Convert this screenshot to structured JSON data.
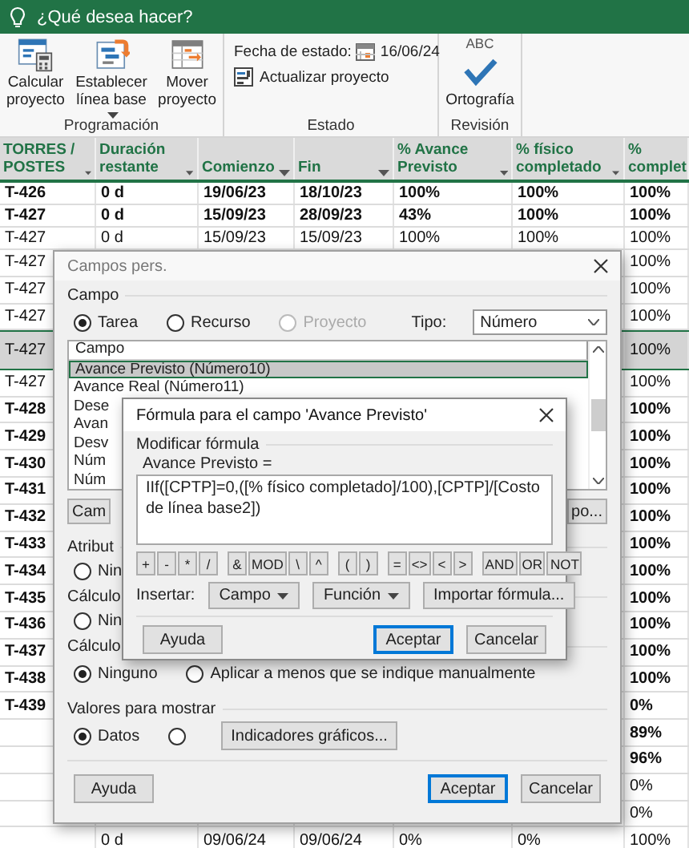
{
  "tell_me": {
    "label": "¿Qué desea hacer?"
  },
  "ribbon": {
    "groups": [
      {
        "label": "Programación",
        "kind": "large",
        "buttons": [
          {
            "label": "Calcular proyecto",
            "kind": "calculate",
            "dropdown": false
          },
          {
            "label": "Establecer línea base",
            "kind": "baseline",
            "dropdown": true
          },
          {
            "label": "Mover proyecto",
            "kind": "move",
            "dropdown": false
          }
        ]
      },
      {
        "label": "Estado",
        "kind": "status",
        "date_label": "Fecha de estado:",
        "date": "16/06/24",
        "update": "Actualizar proyecto"
      },
      {
        "label": "Revisión",
        "kind": "large",
        "buttons": [
          {
            "label": "Ortografía",
            "kind": "spelling",
            "icon_text": "ABC",
            "dropdown": false
          }
        ]
      }
    ]
  },
  "table": {
    "columns": [
      {
        "label": "TORRES / POSTES",
        "filter": true
      },
      {
        "label": "Duración restante",
        "filter": true
      },
      {
        "label": "Comienzo",
        "filter": true
      },
      {
        "label": "Fin",
        "filter": true
      },
      {
        "label": "% Avance Previsto",
        "filter": true
      },
      {
        "label": "% físico completado",
        "filter": true
      },
      {
        "label": "% complet"
      }
    ],
    "rows": [
      {
        "torres": "T-426",
        "duracion": "0 d",
        "comienzo": "19/06/23",
        "fin": "18/10/23",
        "avance_previsto": "100%",
        "fisico_completado": "100%",
        "completado": "100%",
        "bold": true,
        "selected": false
      },
      {
        "torres": "T-427",
        "duracion": "0 d",
        "comienzo": "15/09/23",
        "fin": "28/09/23",
        "avance_previsto": "43%",
        "fisico_completado": "100%",
        "completado": "100%",
        "bold": true,
        "selected": false
      },
      {
        "torres": "T-427",
        "duracion": "0 d",
        "comienzo": "15/09/23",
        "fin": "15/09/23",
        "avance_previsto": "100%",
        "fisico_completado": "100%",
        "completado": "100%",
        "bold": false,
        "selected": false
      },
      {
        "torres": "T-427",
        "completado": "100%",
        "bold": false,
        "selected": false
      },
      {
        "torres": "T-427",
        "completado": "100%",
        "bold": false,
        "selected": false
      },
      {
        "torres": "T-427",
        "completado": "100%",
        "bold": false,
        "selected": false
      },
      {
        "torres": "T-427",
        "completado": "100%",
        "bold": false,
        "selected": true
      },
      {
        "torres": "T-427",
        "completado": "100%",
        "bold": false,
        "selected": false
      },
      {
        "torres": "T-428",
        "completado": "100%",
        "bold": true,
        "selected": false
      },
      {
        "torres": "T-429",
        "completado": "100%",
        "bold": true,
        "selected": false
      },
      {
        "torres": "T-430",
        "completado": "100%",
        "bold": true,
        "selected": false
      },
      {
        "torres": "T-431",
        "completado": "100%",
        "bold": true,
        "selected": false
      },
      {
        "torres": "T-432",
        "completado": "100%",
        "bold": true,
        "selected": false
      },
      {
        "torres": "T-433",
        "completado": "100%",
        "bold": true,
        "selected": false
      },
      {
        "torres": "T-434",
        "completado": "100%",
        "bold": true,
        "selected": false
      },
      {
        "torres": "T-435",
        "completado": "100%",
        "bold": true,
        "selected": false
      },
      {
        "torres": "T-436",
        "completado": "100%",
        "bold": true,
        "selected": false
      },
      {
        "torres": "T-437",
        "completado": "100%",
        "bold": true,
        "selected": false
      },
      {
        "torres": "T-438",
        "completado": "100%",
        "bold": true,
        "selected": false
      },
      {
        "torres": "T-439",
        "completado": "0%",
        "bold": true,
        "selected": false
      },
      {
        "completado": "89%",
        "bold": true,
        "selected": false
      },
      {
        "completado": "96%",
        "bold": true,
        "selected": false
      },
      {
        "completado": "0%",
        "bold": false,
        "selected": false
      },
      {
        "completado": "0%",
        "bold": false,
        "selected": false
      },
      {
        "duracion": "0 d",
        "comienzo": "09/06/24",
        "fin": "09/06/24",
        "avance_previsto": "0%",
        "fisico_completado": "0%",
        "completado": "100%",
        "bold": false,
        "selected": false
      }
    ]
  },
  "custom_fields_dialog": {
    "title": "Campos pers.",
    "field_section": "Campo",
    "field_types": [
      {
        "label": "Tarea",
        "selected": true,
        "disabled": false
      },
      {
        "label": "Recurso",
        "selected": false,
        "disabled": false
      },
      {
        "label": "Proyecto",
        "selected": false,
        "disabled": true
      }
    ],
    "type_label": "Tipo:",
    "type": {
      "value": "Número"
    },
    "field_list": {
      "header": "Campo",
      "items": [
        {
          "label": "Avance Previsto (Número10)",
          "selected": true
        },
        {
          "label": "Avance Real (Número11)",
          "selected": false
        },
        {
          "label": "Dese",
          "selected": false
        },
        {
          "label": "Avan",
          "selected": false
        },
        {
          "label": "Desv",
          "selected": false
        },
        {
          "label": "Núm",
          "selected": false
        },
        {
          "label": "Núm",
          "selected": false
        }
      ]
    },
    "list_buttons": [
      "Cam",
      "po..."
    ],
    "sections": [
      {
        "label": "Atribut",
        "options": [
          {
            "label": "Nin",
            "selected": false
          }
        ]
      },
      {
        "label": "Cálculo",
        "options": [
          {
            "label": "Nin",
            "selected": false
          }
        ]
      },
      {
        "label": "Cálculo",
        "options": [
          {
            "label": "Ninguno",
            "selected": true
          },
          {
            "label": "Aplicar a menos que se indique manualmente",
            "selected": false
          }
        ]
      }
    ],
    "display_values": {
      "label": "Valores para mostrar",
      "options": [
        {
          "label": "Datos",
          "selected": true
        },
        {
          "selected": false
        }
      ],
      "button": "Indicadores gráficos..."
    },
    "buttons": [
      {
        "label": "Ayuda",
        "default": false
      },
      {
        "label": "Aceptar",
        "default": true
      },
      {
        "label": "Cancelar",
        "default": false
      }
    ]
  },
  "formula_dialog": {
    "title": "Fórmula para el campo 'Avance Previsto'",
    "section": "Modificar fórmula",
    "field_label": "Avance Previsto =",
    "formula": "IIf([CPTP]=0,([% físico completado]/100),[CPTP]/[Costo de línea base2])",
    "operator_groups": [
      [
        "+",
        "-",
        "*",
        "/"
      ],
      [
        "&",
        "MOD",
        "\\",
        "^"
      ],
      [
        "(",
        ")"
      ],
      [
        "=",
        "<>",
        "<",
        ">"
      ],
      [
        "AND",
        "OR",
        "NOT"
      ]
    ],
    "insert_label": "Insertar:",
    "insert_buttons": [
      {
        "label": "Campo",
        "dropdown": true
      },
      {
        "label": "Función",
        "dropdown": true
      },
      {
        "label": "Importar fórmula...",
        "dropdown": false
      }
    ],
    "buttons": [
      {
        "label": "Ayuda",
        "default": false
      },
      {
        "label": "Aceptar",
        "default": true
      },
      {
        "label": "Cancelar",
        "default": false
      }
    ]
  }
}
